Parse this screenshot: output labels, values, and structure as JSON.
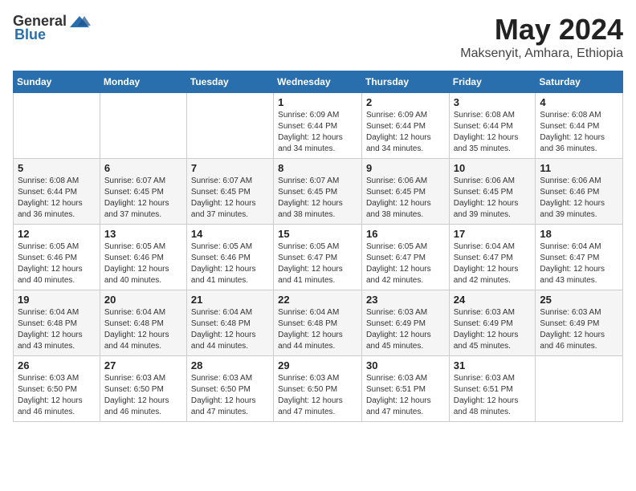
{
  "header": {
    "logo_general": "General",
    "logo_blue": "Blue",
    "month": "May 2024",
    "location": "Maksenyit, Amhara, Ethiopia"
  },
  "weekdays": [
    "Sunday",
    "Monday",
    "Tuesday",
    "Wednesday",
    "Thursday",
    "Friday",
    "Saturday"
  ],
  "weeks": [
    [
      {
        "day": "",
        "text": ""
      },
      {
        "day": "",
        "text": ""
      },
      {
        "day": "",
        "text": ""
      },
      {
        "day": "1",
        "text": "Sunrise: 6:09 AM\nSunset: 6:44 PM\nDaylight: 12 hours and 34 minutes."
      },
      {
        "day": "2",
        "text": "Sunrise: 6:09 AM\nSunset: 6:44 PM\nDaylight: 12 hours and 34 minutes."
      },
      {
        "day": "3",
        "text": "Sunrise: 6:08 AM\nSunset: 6:44 PM\nDaylight: 12 hours and 35 minutes."
      },
      {
        "day": "4",
        "text": "Sunrise: 6:08 AM\nSunset: 6:44 PM\nDaylight: 12 hours and 36 minutes."
      }
    ],
    [
      {
        "day": "5",
        "text": "Sunrise: 6:08 AM\nSunset: 6:44 PM\nDaylight: 12 hours and 36 minutes."
      },
      {
        "day": "6",
        "text": "Sunrise: 6:07 AM\nSunset: 6:45 PM\nDaylight: 12 hours and 37 minutes."
      },
      {
        "day": "7",
        "text": "Sunrise: 6:07 AM\nSunset: 6:45 PM\nDaylight: 12 hours and 37 minutes."
      },
      {
        "day": "8",
        "text": "Sunrise: 6:07 AM\nSunset: 6:45 PM\nDaylight: 12 hours and 38 minutes."
      },
      {
        "day": "9",
        "text": "Sunrise: 6:06 AM\nSunset: 6:45 PM\nDaylight: 12 hours and 38 minutes."
      },
      {
        "day": "10",
        "text": "Sunrise: 6:06 AM\nSunset: 6:45 PM\nDaylight: 12 hours and 39 minutes."
      },
      {
        "day": "11",
        "text": "Sunrise: 6:06 AM\nSunset: 6:46 PM\nDaylight: 12 hours and 39 minutes."
      }
    ],
    [
      {
        "day": "12",
        "text": "Sunrise: 6:05 AM\nSunset: 6:46 PM\nDaylight: 12 hours and 40 minutes."
      },
      {
        "day": "13",
        "text": "Sunrise: 6:05 AM\nSunset: 6:46 PM\nDaylight: 12 hours and 40 minutes."
      },
      {
        "day": "14",
        "text": "Sunrise: 6:05 AM\nSunset: 6:46 PM\nDaylight: 12 hours and 41 minutes."
      },
      {
        "day": "15",
        "text": "Sunrise: 6:05 AM\nSunset: 6:47 PM\nDaylight: 12 hours and 41 minutes."
      },
      {
        "day": "16",
        "text": "Sunrise: 6:05 AM\nSunset: 6:47 PM\nDaylight: 12 hours and 42 minutes."
      },
      {
        "day": "17",
        "text": "Sunrise: 6:04 AM\nSunset: 6:47 PM\nDaylight: 12 hours and 42 minutes."
      },
      {
        "day": "18",
        "text": "Sunrise: 6:04 AM\nSunset: 6:47 PM\nDaylight: 12 hours and 43 minutes."
      }
    ],
    [
      {
        "day": "19",
        "text": "Sunrise: 6:04 AM\nSunset: 6:48 PM\nDaylight: 12 hours and 43 minutes."
      },
      {
        "day": "20",
        "text": "Sunrise: 6:04 AM\nSunset: 6:48 PM\nDaylight: 12 hours and 44 minutes."
      },
      {
        "day": "21",
        "text": "Sunrise: 6:04 AM\nSunset: 6:48 PM\nDaylight: 12 hours and 44 minutes."
      },
      {
        "day": "22",
        "text": "Sunrise: 6:04 AM\nSunset: 6:48 PM\nDaylight: 12 hours and 44 minutes."
      },
      {
        "day": "23",
        "text": "Sunrise: 6:03 AM\nSunset: 6:49 PM\nDaylight: 12 hours and 45 minutes."
      },
      {
        "day": "24",
        "text": "Sunrise: 6:03 AM\nSunset: 6:49 PM\nDaylight: 12 hours and 45 minutes."
      },
      {
        "day": "25",
        "text": "Sunrise: 6:03 AM\nSunset: 6:49 PM\nDaylight: 12 hours and 46 minutes."
      }
    ],
    [
      {
        "day": "26",
        "text": "Sunrise: 6:03 AM\nSunset: 6:50 PM\nDaylight: 12 hours and 46 minutes."
      },
      {
        "day": "27",
        "text": "Sunrise: 6:03 AM\nSunset: 6:50 PM\nDaylight: 12 hours and 46 minutes."
      },
      {
        "day": "28",
        "text": "Sunrise: 6:03 AM\nSunset: 6:50 PM\nDaylight: 12 hours and 47 minutes."
      },
      {
        "day": "29",
        "text": "Sunrise: 6:03 AM\nSunset: 6:50 PM\nDaylight: 12 hours and 47 minutes."
      },
      {
        "day": "30",
        "text": "Sunrise: 6:03 AM\nSunset: 6:51 PM\nDaylight: 12 hours and 47 minutes."
      },
      {
        "day": "31",
        "text": "Sunrise: 6:03 AM\nSunset: 6:51 PM\nDaylight: 12 hours and 48 minutes."
      },
      {
        "day": "",
        "text": ""
      }
    ]
  ]
}
